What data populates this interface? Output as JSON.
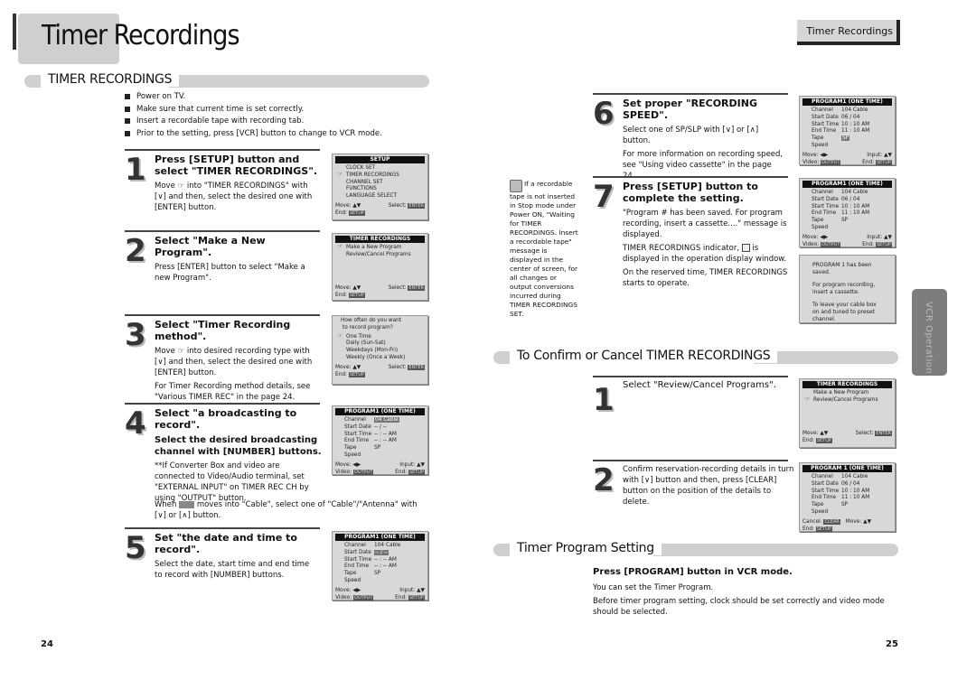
{
  "page": {
    "title_part1": "Timer",
    "title_part2": " Recordings",
    "chapter_tab": "Timer Recordings",
    "side_tab": "VCR Operation",
    "page_left": "24",
    "page_right": "25"
  },
  "section_timer": {
    "title": "TIMER RECORDINGS",
    "bullets": [
      "Power on TV.",
      "Make sure that current time is set correctly.",
      "Insert a recordable tape with recording tab.",
      "Prior to the setting, press [VCR] button to change to VCR mode."
    ]
  },
  "steps": {
    "s1": {
      "num": "1",
      "head": "Press [SETUP] button and select \"TIMER RECORDINGS\".",
      "text_a": "Move ",
      "text_b": " into \"TIMER RECORDINGS\" with [∨] and then, select the desired one with [ENTER] button."
    },
    "s2": {
      "num": "2",
      "head": "Select \"Make a New Program\".",
      "text": "Press [ENTER] button to select \"Make a new Program\"."
    },
    "s3": {
      "num": "3",
      "head": "Select \"Timer Recording method\".",
      "text_a": "Move ",
      "text_b": " into desired recording type with [∨] and then, select the desired one with [ENTER] button.",
      "text2": "For Timer Recording method details, see \"Various TIMER REC\" in the page 24."
    },
    "s4": {
      "num": "4",
      "head": "Select \"a broadcasting to record\".",
      "subhead": "Select the desired broadcasting channel with [NUMBER] buttons.",
      "note": "**If Converter Box and video are connected to Video/Audio terminal, set \"EXTERNAL INPUT\" on TIMER REC CH by using \"OUTPUT\" button.",
      "when_a": "When ",
      "when_b": " moves into \"Cable\", select one of \"Cable\"/\"Antenna\" with [∨] or [∧] button."
    },
    "s5": {
      "num": "5",
      "head": "Set \"the date and time to record\".",
      "text": "Select the date, start time and end time to record with [NUMBER] buttons."
    },
    "s6": {
      "num": "6",
      "head": "Set proper \"RECORDING SPEED\".",
      "text": "Select one of SP/SLP with [∨] or [∧] button.",
      "text2": "For more information on recording speed, see \"Using video cassette\" in the page 24."
    },
    "s7": {
      "num": "7",
      "head": "Press [SETUP] button to complete the setting.",
      "text": "\"Program # has been saved. For program recording, insert a cassette....\" message is displayed.",
      "text2a": "TIMER RECORDINGS indicator, ",
      "text2b": " is displayed in the operation display window.",
      "text3": "On the reserved time, TIMER RECORDINGS starts to operate."
    }
  },
  "tip": {
    "text_first": "If a recordable tape is not inserted in Stop mode under Power ON, \"Waiting for TIMER RECORDINGS. Insert a recordable tape\" message is displayed in the center of screen, for all changes or output conversions incurred during TIMER RECORDINGS SET."
  },
  "section_confirm": {
    "title": "To Confirm or Cancel TIMER RECORDINGS",
    "s1": {
      "num": "1",
      "head": "Select \"Review/Cancel Programs\"."
    },
    "s2": {
      "num": "2",
      "text": "Confirm reservation-recording details in turn with [∨] button and then, press [CLEAR] button on the position of the details to delete."
    }
  },
  "section_program": {
    "title": "Timer Program Setting",
    "head": "Press [PROGRAM] button in VCR mode.",
    "text1": "You can set the Timer Program.",
    "text2": "Before timer program setting, clock should be set correctly  and video mode should be selected."
  },
  "osd": {
    "setup": {
      "title": "SETUP",
      "items": [
        "CLOCK SET",
        "TIMER RECORDINGS",
        "CHANNEL SET",
        "FUNCTIONS",
        "LANGUAGE SELECT"
      ],
      "move": "Move:",
      "select": "Select:",
      "enter": "ENTER",
      "end": "End:",
      "setup": "SETUP"
    },
    "timer_menu": {
      "title": "TIMER RECORDINGS",
      "items": [
        "Make a New Program",
        "Review/Cancel Programs"
      ]
    },
    "method": {
      "question1": "How often do you want",
      "question2": "to record program?",
      "items": [
        "One Time",
        "Daily (Sun-Sat)",
        "Weekdays (Mon-Fri)",
        "Weekly (Once a Week)"
      ]
    },
    "program": {
      "title": "PROGRAM1  (ONE TIME)",
      "title_confirm": "PROGRAM 1 (ONE TIME)",
      "labels": [
        "Channel",
        "Start Date",
        "Start Time",
        "End Time",
        "Tape Speed"
      ],
      "step4": [
        "04 Cable",
        "-- / --",
        "-- : -- AM",
        "-- : -- AM",
        "SP"
      ],
      "step5": [
        "104 Cable",
        "-- / --",
        "-- : -- AM",
        "-- : -- AM",
        "SP"
      ],
      "filled": [
        "104 Cable",
        "06 / 04",
        "10 : 10 AM",
        "11 : 10 AM",
        "SP"
      ],
      "move": "Move:",
      "input": "Input:",
      "video": "Video:",
      "output": "OUTPUT",
      "end": "End:",
      "setup": "SETUP",
      "cancel": "Cancel:",
      "clear": "CLEAR"
    },
    "saved": {
      "line1": "PROGRAM 1 has been saved.",
      "line2": "For program recording, insert a cassette.",
      "line3": "To leave your cable box on and tuned to preset channel."
    }
  }
}
